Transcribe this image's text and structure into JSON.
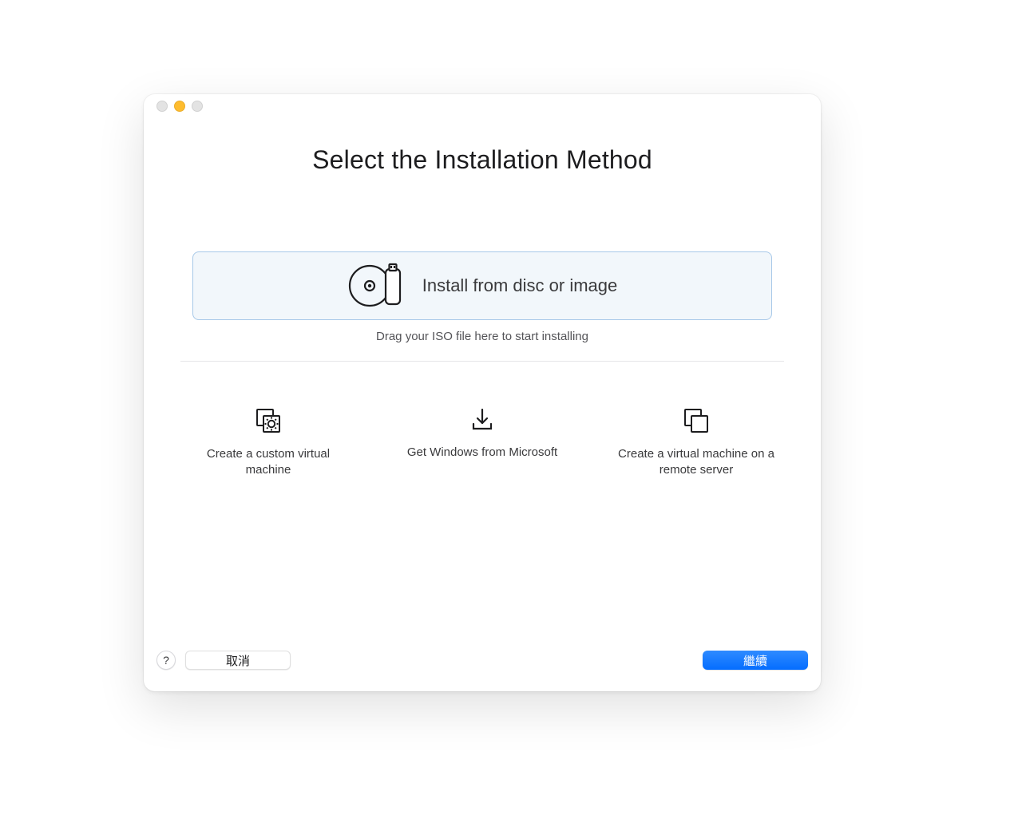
{
  "title": "Select the Installation Method",
  "primary_option": {
    "label": "Install from disc or image",
    "hint": "Drag your ISO file here to start installing",
    "icon": "disc-usb-icon"
  },
  "secondary_options": [
    {
      "label": "Create a custom virtual machine",
      "icon": "custom-vm-icon"
    },
    {
      "label": "Get Windows from Microsoft",
      "icon": "download-icon"
    },
    {
      "label": "Create a virtual machine on a remote server",
      "icon": "remote-server-icon"
    }
  ],
  "footer": {
    "help": "?",
    "cancel": "取消",
    "continue": "繼續"
  },
  "colors": {
    "accent": "#046dff",
    "primary_option_bg": "#f2f7fb",
    "primary_option_border": "#a7c8e8"
  }
}
